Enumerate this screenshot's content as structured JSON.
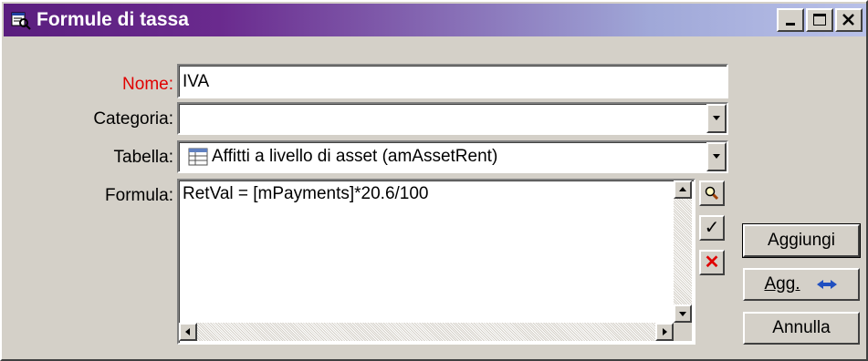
{
  "window": {
    "title": "Formule di tassa",
    "controls": {
      "minimize": "minimize-icon",
      "maximize": "maximize-icon",
      "close": "close-icon"
    }
  },
  "form": {
    "nome_label": "Nome:",
    "nome_value": "IVA",
    "categoria_label": "Categoria:",
    "categoria_value": "",
    "tabella_label": "Tabella:",
    "tabella_value": "Affitti a livello di asset (amAssetRent)",
    "tabella_icon": "table-icon",
    "formula_label": "Formula:",
    "formula_value": "RetVal = [mPayments]*20.6/100"
  },
  "formula_tools": {
    "search": "search-icon",
    "check_mark": "✓",
    "clear_mark": "✕"
  },
  "buttons": {
    "add": "Aggiungi",
    "update": "Agg.",
    "cancel": "Annulla"
  },
  "colors": {
    "required_label": "#e00000",
    "title_gradient_start": "#5a1e7e",
    "title_gradient_end": "#b8c0e8"
  }
}
